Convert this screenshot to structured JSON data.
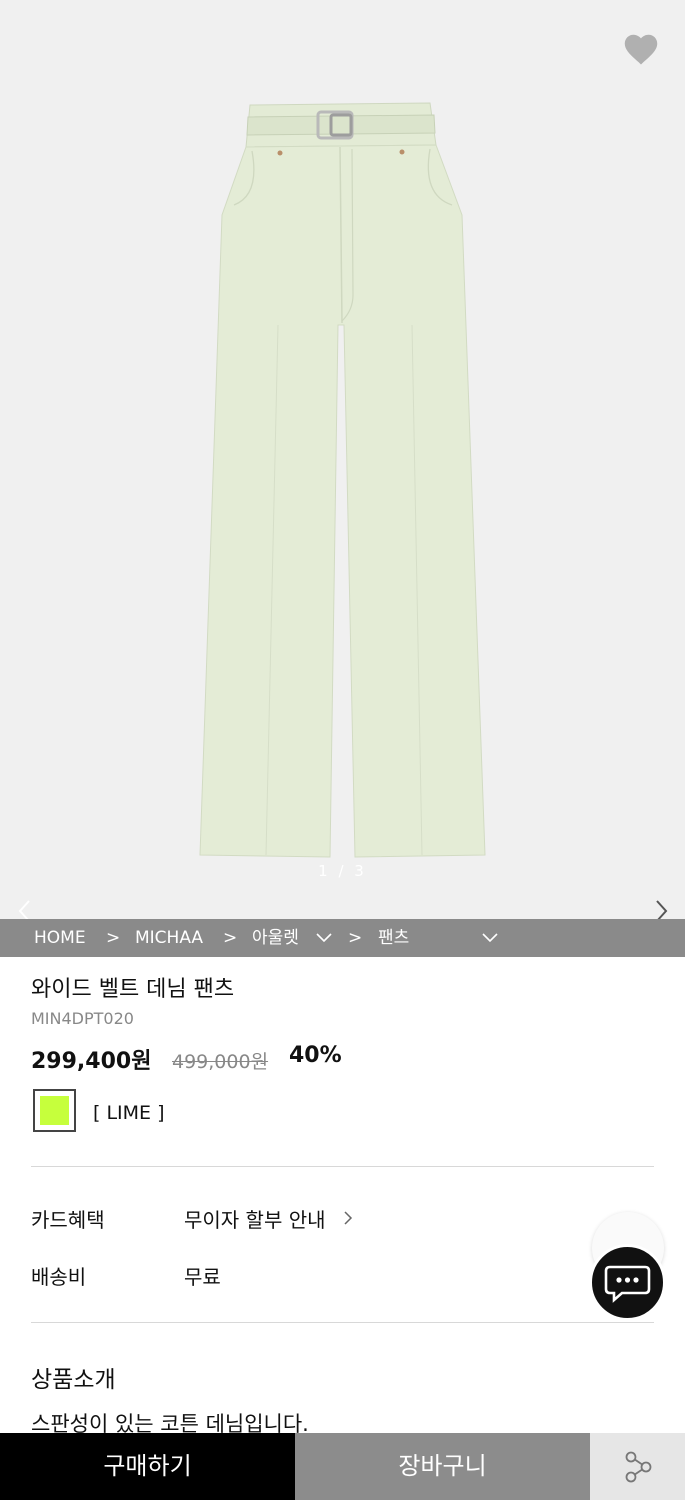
{
  "gallery": {
    "page_indicator": "1 / 3",
    "icons": {
      "wishlist": "heart-icon",
      "prev": "chevron-left-icon",
      "next": "chevron-right-icon"
    }
  },
  "breadcrumb": {
    "home": "HOME",
    "sep": ">",
    "brand": "MICHAA",
    "category": "아울렛",
    "subcategory": "팬츠"
  },
  "product": {
    "title": "와이드 벨트 데님 팬츠",
    "code": "MIN4DPT020",
    "price": "299,400원",
    "original_price": "499,000원",
    "discount": "40%",
    "color_name": "[ LIME ]",
    "swatch_color": "#c6ff3c"
  },
  "benefits": {
    "card_label": "카드혜택",
    "card_value": "무이자 할부 안내",
    "shipping_label": "배송비",
    "shipping_value": "무료"
  },
  "intro": {
    "title": "상품소개",
    "text": "스판성이 있는 코튼 데님입니다."
  },
  "actions": {
    "buy": "구매하기",
    "cart": "장바구니",
    "share_icon": "share-icon",
    "chat_icon": "chat-icon"
  },
  "colors": {
    "pants": "#e4ecd6",
    "accent_dark": "#000000",
    "cart_gray": "#8c8c8c"
  }
}
